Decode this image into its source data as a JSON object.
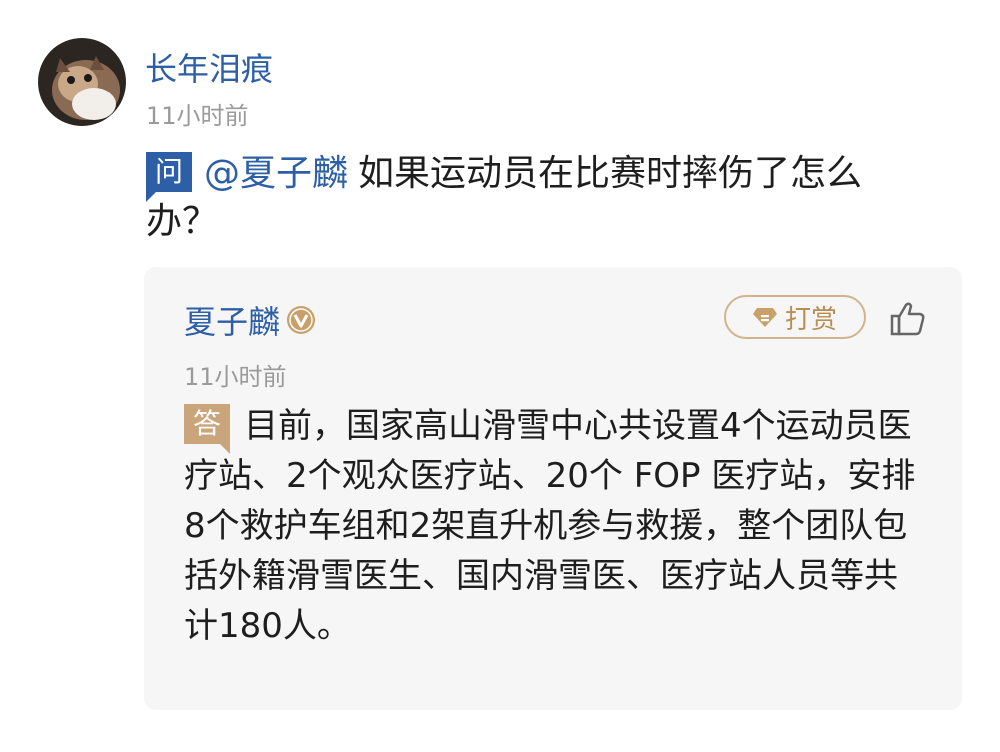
{
  "post": {
    "username": "长年泪痕",
    "time": "11小时前",
    "avatar_icon": "cat-avatar-icon"
  },
  "question": {
    "badge": "问",
    "mention": "@夏子麟",
    "text": "如果运动员在比赛时摔伤了怎么办？"
  },
  "answer": {
    "author": "夏子麟",
    "verified_icon": "verified-v-icon",
    "time": "11小时前",
    "reward_label": "打赏",
    "like_icon": "thumbs-up-icon",
    "badge": "答",
    "text": "目前，国家高山滑雪中心共设置4个运动员医疗站、2个观众医疗站、20个 FOP 医疗站，安排8个救护车组和2架直升机参与救援，整个团队包括外籍滑雪医生、国内滑雪医、医疗站人员等共计180人。"
  },
  "colors": {
    "link_blue": "#2d5fa7",
    "answer_gold": "#caa57c",
    "card_bg": "#f6f6f6",
    "muted_gray": "#9a9a9a"
  }
}
